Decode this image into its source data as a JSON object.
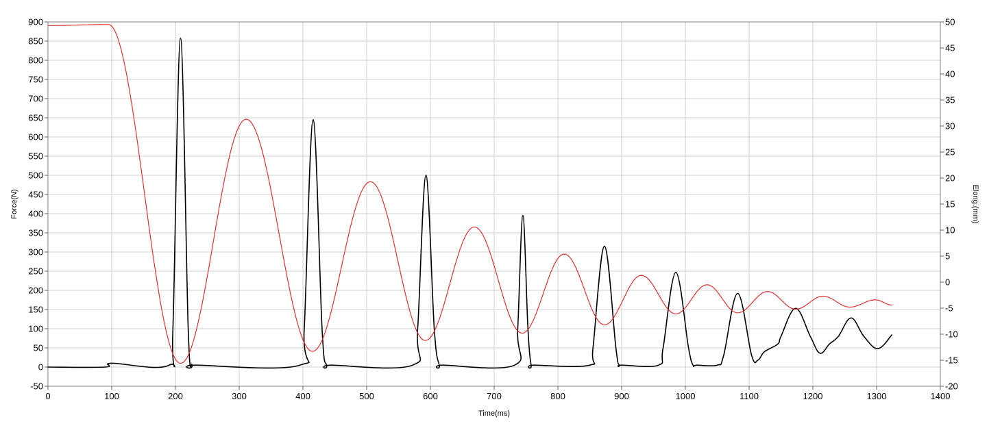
{
  "chart_data": {
    "type": "line",
    "title": "",
    "xlabel": "Time(ms)",
    "ylabel_left": "Force(N)",
    "ylabel_right": "Elong.(mm)",
    "xlim": [
      0,
      1400
    ],
    "ylim_left": [
      -50,
      900
    ],
    "ylim_right": [
      -20,
      50
    ],
    "x_ticks": [
      0,
      100,
      200,
      300,
      400,
      500,
      600,
      700,
      800,
      900,
      1000,
      1100,
      1200,
      1300,
      1400
    ],
    "y_left_ticks": [
      -50,
      0,
      50,
      100,
      150,
      200,
      250,
      300,
      350,
      400,
      450,
      500,
      550,
      600,
      650,
      700,
      750,
      800,
      850,
      900
    ],
    "y_right_ticks": [
      -20,
      -15,
      -10,
      -5,
      0,
      5,
      10,
      15,
      20,
      25,
      30,
      35,
      40,
      45,
      50
    ],
    "grid": true,
    "colors": {
      "force": "#000000",
      "elongation": "#e03030",
      "grid": "#d0d0d0"
    },
    "series": [
      {
        "name": "Force(N)",
        "axis": "left",
        "color": "#000000",
        "x": [
          0,
          90,
          100,
          190,
          196,
          208,
          220,
          226,
          232,
          395,
          402,
          416,
          430,
          437,
          445,
          572,
          580,
          593,
          606,
          614,
          620,
          732,
          737,
          745,
          753,
          758,
          762,
          850,
          855,
          873,
          891,
          896,
          900,
          958,
          965,
          985,
          1005,
          1012,
          1018,
          1050,
          1060,
          1082,
          1104,
          1114,
          1124,
          1145,
          1150,
          1173,
          1196,
          1211,
          1226,
          1240,
          1260,
          1280,
          1302,
          1324
        ],
        "y": [
          0,
          0,
          10,
          5,
          100,
          858,
          100,
          5,
          5,
          5,
          100,
          645,
          100,
          5,
          5,
          5,
          100,
          500,
          100,
          5,
          5,
          5,
          100,
          395,
          100,
          5,
          5,
          5,
          50,
          315,
          50,
          5,
          5,
          5,
          50,
          247,
          50,
          5,
          5,
          5,
          30,
          192,
          30,
          18,
          40,
          60,
          80,
          153,
          80,
          36,
          60,
          80,
          128,
          80,
          48,
          84
        ]
      },
      {
        "name": "Elong.(mm)",
        "axis": "right",
        "color": "#e03030",
        "x": [
          0,
          95,
          208,
          311,
          415,
          506,
          592,
          669,
          744,
          810,
          873,
          931,
          985,
          1034,
          1082,
          1129,
          1173,
          1216,
          1258,
          1298,
          1324
        ],
        "y": [
          49.3,
          49.5,
          -15.6,
          31.3,
          -13.3,
          19.3,
          -11.2,
          10.6,
          -9.8,
          5.4,
          -8.2,
          1.3,
          -6.1,
          -0.5,
          -5.9,
          -1.8,
          -5.2,
          -2.7,
          -4.8,
          -3.4,
          -4.4
        ]
      }
    ]
  }
}
